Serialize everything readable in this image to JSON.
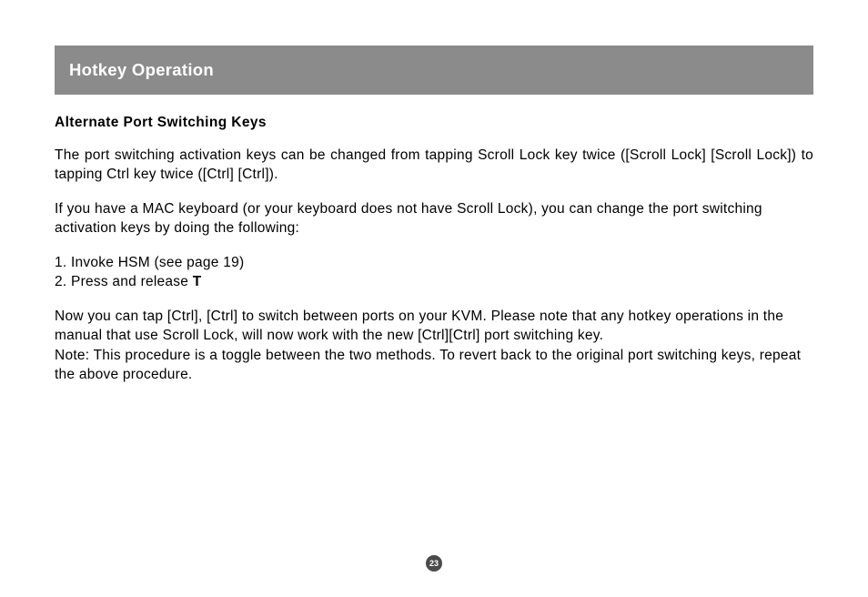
{
  "header": {
    "title": "Hotkey Operation"
  },
  "body": {
    "subheading": "Alternate Port Switching Keys",
    "para1": "The port switching activation keys can be changed from tapping Scroll Lock key twice ([Scroll Lock] [Scroll Lock]) to tapping Ctrl key twice ([Ctrl] [Ctrl]).",
    "para2": "If you have a MAC keyboard (or your keyboard does not have Scroll Lock), you can change the port switching activation keys by doing the following:",
    "list": {
      "item1": "1.  Invoke HSM (see page 19)",
      "item2_prefix": "2.  Press and release ",
      "item2_bold": "T"
    },
    "para3": "Now you can tap [Ctrl], [Ctrl] to switch between ports on your KVM.  Please note that any hotkey operations in the manual that use Scroll Lock, will now work with the new [Ctrl][Ctrl] port switching key.",
    "para4": "Note:  This procedure is a toggle between the two methods.  To revert back to the original port switching keys, repeat the above procedure."
  },
  "page_number": "23"
}
